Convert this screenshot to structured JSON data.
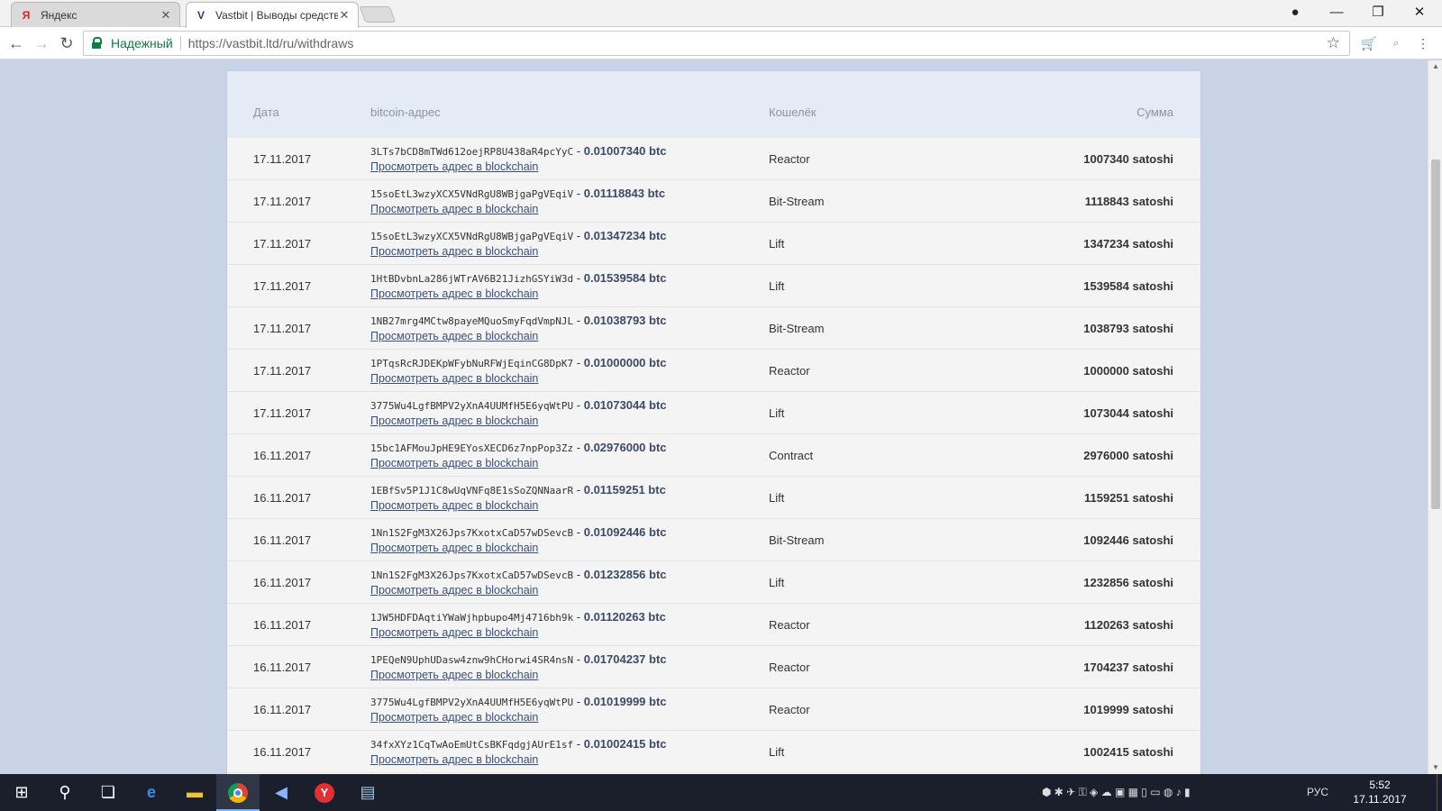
{
  "browser": {
    "tabs": [
      {
        "title": "Яндекс",
        "favicon": "Я"
      },
      {
        "title": "Vastbit | Выводы средств",
        "favicon": "V"
      }
    ],
    "secure_label": "Надежный",
    "url": "https://vastbit.ltd/ru/withdraws"
  },
  "table": {
    "headers": {
      "date": "Дата",
      "address": "bitcoin-адрес",
      "wallet": "Кошелёк",
      "amount": "Сумма"
    },
    "link_label": "Просмотреть адрес в blockchain",
    "rows": [
      {
        "date": "17.11.2017",
        "address": "3LTs7bCD8mTWd612oejRP8U438aR4pcYyC",
        "btc": "0.01007340 btc",
        "wallet": "Reactor",
        "amount": "1007340 satoshi"
      },
      {
        "date": "17.11.2017",
        "address": "15soEtL3wzyXCX5VNdRgU8WBjgaPgVEqiV",
        "btc": "0.01118843 btc",
        "wallet": "Bit-Stream",
        "amount": "1118843 satoshi"
      },
      {
        "date": "17.11.2017",
        "address": "15soEtL3wzyXCX5VNdRgU8WBjgaPgVEqiV",
        "btc": "0.01347234 btc",
        "wallet": "Lift",
        "amount": "1347234 satoshi"
      },
      {
        "date": "17.11.2017",
        "address": "1HtBDvbnLa286jWTrAV6B21JizhGSYiW3d",
        "btc": "0.01539584 btc",
        "wallet": "Lift",
        "amount": "1539584 satoshi"
      },
      {
        "date": "17.11.2017",
        "address": "1NB27mrg4MCtw8payeMQuoSmyFqdVmpNJL",
        "btc": "0.01038793 btc",
        "wallet": "Bit-Stream",
        "amount": "1038793 satoshi"
      },
      {
        "date": "17.11.2017",
        "address": "1PTqsRcRJDEKpWFybNuRFWjEqinCG8DpK7",
        "btc": "0.01000000 btc",
        "wallet": "Reactor",
        "amount": "1000000 satoshi"
      },
      {
        "date": "17.11.2017",
        "address": "3775Wu4LgfBMPV2yXnA4UUMfH5E6yqWtPU",
        "btc": "0.01073044 btc",
        "wallet": "Lift",
        "amount": "1073044 satoshi"
      },
      {
        "date": "16.11.2017",
        "address": "15bc1AFMouJpHE9EYosXECD6z7npPop3Zz",
        "btc": "0.02976000 btc",
        "wallet": "Contract",
        "amount": "2976000 satoshi"
      },
      {
        "date": "16.11.2017",
        "address": "1EBfSv5P1J1C8wUqVNFq8E1sSoZQNNaarR",
        "btc": "0.01159251 btc",
        "wallet": "Lift",
        "amount": "1159251 satoshi"
      },
      {
        "date": "16.11.2017",
        "address": "1Nn1S2FgM3X26Jps7KxotxCaD57wDSevcB",
        "btc": "0.01092446 btc",
        "wallet": "Bit-Stream",
        "amount": "1092446 satoshi"
      },
      {
        "date": "16.11.2017",
        "address": "1Nn1S2FgM3X26Jps7KxotxCaD57wDSevcB",
        "btc": "0.01232856 btc",
        "wallet": "Lift",
        "amount": "1232856 satoshi"
      },
      {
        "date": "16.11.2017",
        "address": "1JW5HDFDAqtiYWaWjhpbupo4Mj4716bh9k",
        "btc": "0.01120263 btc",
        "wallet": "Reactor",
        "amount": "1120263 satoshi"
      },
      {
        "date": "16.11.2017",
        "address": "1PEQeN9UphUDasw4znw9hCHorwi4SR4nsN",
        "btc": "0.01704237 btc",
        "wallet": "Reactor",
        "amount": "1704237 satoshi"
      },
      {
        "date": "16.11.2017",
        "address": "3775Wu4LgfBMPV2yXnA4UUMfH5E6yqWtPU",
        "btc": "0.01019999 btc",
        "wallet": "Reactor",
        "amount": "1019999 satoshi"
      },
      {
        "date": "16.11.2017",
        "address": "34fxXYz1CqTwAoEmUtCsBKFqdgjAUrE1sf",
        "btc": "0.01002415 btc",
        "wallet": "Lift",
        "amount": "1002415 satoshi"
      }
    ]
  },
  "taskbar": {
    "language": "РУС",
    "time": "5:52",
    "date": "17.11.2017"
  }
}
